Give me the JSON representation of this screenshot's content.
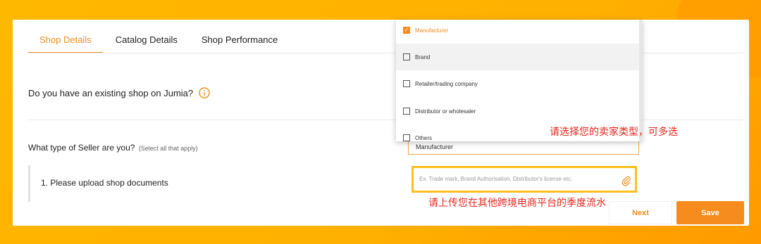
{
  "tabs": [
    {
      "label": "Shop Details",
      "active": true
    },
    {
      "label": "Catalog Details",
      "active": false
    },
    {
      "label": "Shop Performance",
      "active": false
    }
  ],
  "form": {
    "q_existing_shop": "Do you have an existing shop on Jumia?",
    "q_seller_type": "What type of Seller are you?",
    "q_seller_type_hint": "(Select all that apply)",
    "seller_type_value": "Manufacturer",
    "upload_label": "1. Please upload shop documents",
    "upload_placeholder": "Ex. Trade mark, Brand Authorisation, Distributor's license etc."
  },
  "dropdown": {
    "options": [
      {
        "label": "Manufacturer",
        "checked": true
      },
      {
        "label": "Brand",
        "checked": false
      },
      {
        "label": "Retailer/trading company",
        "checked": false
      },
      {
        "label": "Distributor or wholesaler",
        "checked": false
      },
      {
        "label": "Others",
        "checked": false
      }
    ]
  },
  "annotations": {
    "seller_type_note": "请选择您的卖家类型，可多选",
    "upload_note": "请上传您在其他跨境电商平台的季度流水"
  },
  "buttons": {
    "next": "Next",
    "save": "Save"
  },
  "colors": {
    "accent": "#f68b1e",
    "annotation": "#e8271d",
    "background": "#ffb800"
  },
  "icons": {
    "info": "info-icon",
    "attachment": "paperclip-icon",
    "check": "checkmark-icon"
  }
}
